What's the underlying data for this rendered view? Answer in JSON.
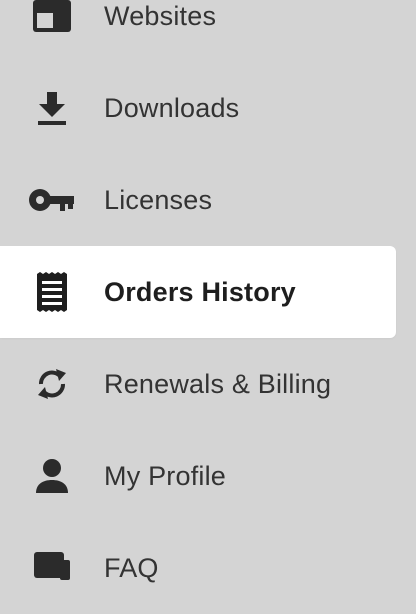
{
  "sidebar": {
    "items": [
      {
        "label": "Websites",
        "icon": "website-icon",
        "active": false
      },
      {
        "label": "Downloads",
        "icon": "download-icon",
        "active": false
      },
      {
        "label": "Licenses",
        "icon": "key-icon",
        "active": false
      },
      {
        "label": "Orders History",
        "icon": "receipt-icon",
        "active": true
      },
      {
        "label": "Renewals & Billing",
        "icon": "refresh-icon",
        "active": false
      },
      {
        "label": "My Profile",
        "icon": "user-icon",
        "active": false
      },
      {
        "label": "FAQ",
        "icon": "faq-icon",
        "active": false
      }
    ]
  },
  "colors": {
    "background": "#d4d4d4",
    "active_background": "#ffffff",
    "text": "#333333",
    "icon": "#2b2b2b"
  }
}
